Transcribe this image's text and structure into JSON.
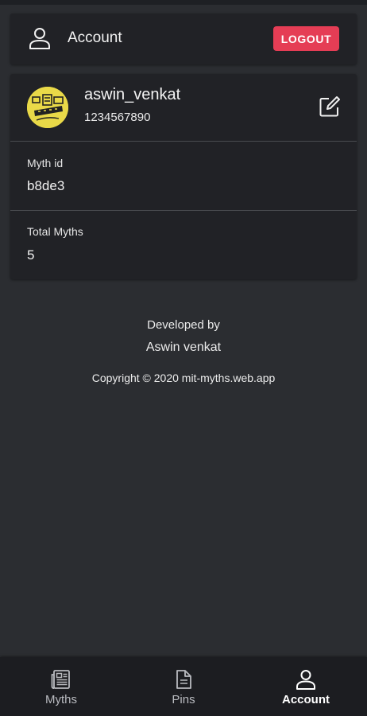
{
  "header": {
    "title": "Account",
    "logout_label": "LOGOUT"
  },
  "profile": {
    "username": "aswin_venkat",
    "phone": "1234567890",
    "fields": [
      {
        "label": "Myth id",
        "value": "b8de3"
      },
      {
        "label": "Total Myths",
        "value": "5"
      }
    ]
  },
  "footer": {
    "developed_by": "Developed by",
    "developer": "Aswin venkat",
    "copyright": "Copyright © 2020 mit-myths.web.app"
  },
  "nav": {
    "items": [
      {
        "label": "Myths",
        "icon": "newspaper-icon",
        "active": false
      },
      {
        "label": "Pins",
        "icon": "document-icon",
        "active": false
      },
      {
        "label": "Account",
        "icon": "person-icon",
        "active": true
      }
    ]
  },
  "colors": {
    "background": "#2b2d31",
    "card": "#212226",
    "accent": "#e53d55",
    "avatar": "#e9d948"
  }
}
